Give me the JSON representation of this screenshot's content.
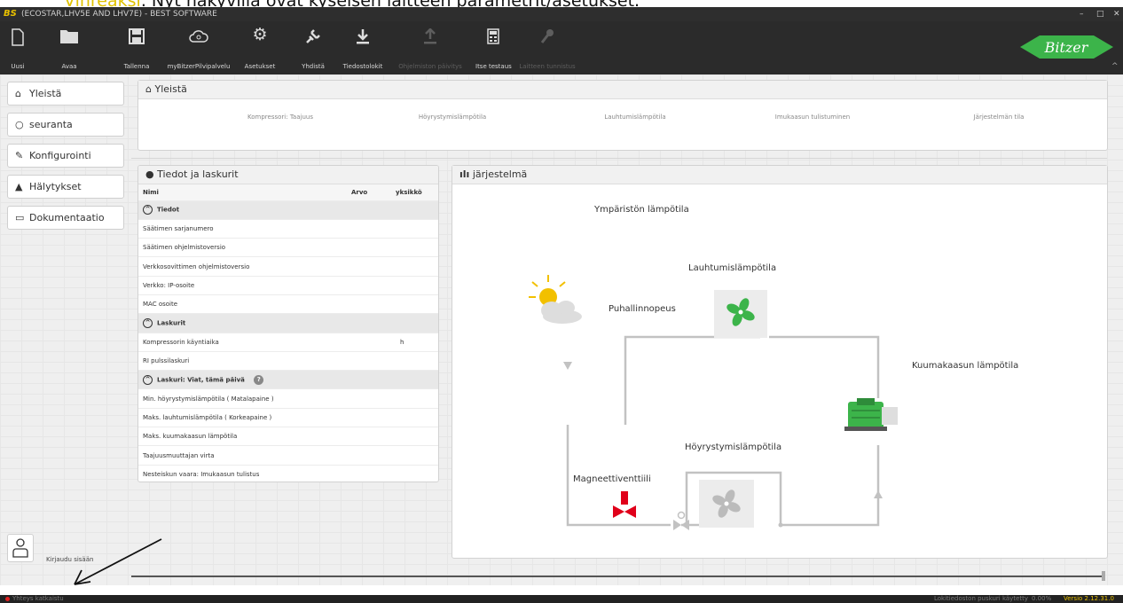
{
  "caption": {
    "prefix": "Vihreäksi",
    "rest": ". Nyt näkyvillä ovat kyseisen laitteen parametrit/asetukset."
  },
  "window": {
    "logo": "BS",
    "title": "(ECOSTAR,LHV5E AND LHV7E) - BEST SOFTWARE"
  },
  "toolbar": {
    "items": [
      {
        "label": "Uusi",
        "icon": "new-file-icon"
      },
      {
        "label": "Avaa",
        "icon": "folder-icon"
      },
      {
        "label": "Tallenna",
        "icon": "save-icon"
      },
      {
        "label": "myBitzerPilvipalvelu",
        "icon": "cloud-icon"
      },
      {
        "label": "Asetukset",
        "icon": "gear-icon"
      },
      {
        "label": "Yhdistä",
        "icon": "plug-icon"
      },
      {
        "label": "Tiedostolokit",
        "icon": "download-icon"
      },
      {
        "label": "Ohjelmiston päivitys",
        "icon": "upload-icon",
        "disabled": true
      },
      {
        "label": "Itse testaus",
        "icon": "calculator-icon"
      },
      {
        "label": "Laitteen tunnistus",
        "icon": "wrench-icon",
        "disabled": true
      }
    ],
    "brand": "Bitzer"
  },
  "sidebar": {
    "items": [
      {
        "label": "Yleistä",
        "icon": "home-icon"
      },
      {
        "label": "seuranta",
        "icon": "search-icon"
      },
      {
        "label": "Konfigurointi",
        "icon": "wrench-icon"
      },
      {
        "label": "Hälytykset",
        "icon": "warning-icon"
      },
      {
        "label": "Dokumentaatio",
        "icon": "book-icon"
      }
    ],
    "login": "Kirjaudu sisään"
  },
  "overview": {
    "title": "Yleistä",
    "gauges": [
      "Kompressori: Taajuus",
      "Höyrystymislämpötila",
      "Lauhtumislämpötila",
      "Imukaasun tulistuminen",
      "Järjestelmän tila"
    ]
  },
  "info": {
    "title": "Tiedot ja laskurit",
    "columns": [
      "Nimi",
      "Arvo",
      "yksikkö"
    ],
    "groups": [
      {
        "title": "Tiedot",
        "rows": [
          {
            "name": "Säätimen sarjanumero",
            "unit": ""
          },
          {
            "name": "Säätimen ohjelmistoversio",
            "unit": ""
          },
          {
            "name": "Verkkosovittimen ohjelmistoversio",
            "unit": ""
          },
          {
            "name": "Verkko: IP-osoite",
            "unit": ""
          },
          {
            "name": "MAC osoite",
            "unit": ""
          }
        ]
      },
      {
        "title": "Laskurit",
        "rows": [
          {
            "name": "Kompressorin käyntiaika",
            "unit": "h"
          },
          {
            "name": "RI pulssilaskuri",
            "unit": ""
          }
        ]
      },
      {
        "title": "Laskuri: Viat, tämä päivä",
        "help": "?",
        "rows": [
          {
            "name": "Min. höyrystymislämpötila ( Matalapaine )",
            "unit": ""
          },
          {
            "name": "Maks. lauhtumislämpötila ( Korkeapaine )",
            "unit": ""
          },
          {
            "name": "Maks. kuumakaasun lämpötila",
            "unit": ""
          },
          {
            "name": "Taajuusmuuttajan virta",
            "unit": ""
          },
          {
            "name": "Nesteiskun vaara: Imukaasun tulistus",
            "unit": ""
          }
        ]
      }
    ]
  },
  "system": {
    "title": "järjestelmä",
    "labels": {
      "ambient": "Ympäristön lämpötila",
      "condensing": "Lauhtumislämpötila",
      "fan_speed": "Puhallinnopeus",
      "hot_gas": "Kuumakaasun lämpötila",
      "evaporating": "Höyrystymislämpötila",
      "solenoid": "Magneettiventtiili"
    }
  },
  "status": {
    "connection": "Yhteys katkaistu",
    "buffer": "Lokitiedoston puskuri käytetty",
    "buffer_value": "0.00%",
    "version": "Versio 2.12.31.0"
  },
  "colors": {
    "accent": "#3cb44a",
    "disconnected": "#e02020",
    "valve": "#e0001a"
  }
}
